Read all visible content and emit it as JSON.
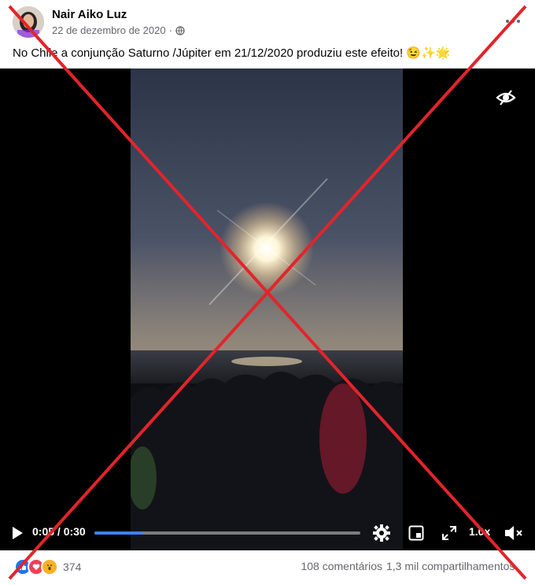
{
  "post": {
    "author": "Nair Aiko Luz",
    "date": "22 de dezembro de 2020",
    "date_separator": "·",
    "privacy_icon": "globe-icon",
    "caption": "No Chile a conjunção Saturno /Júpiter em 21/12/2020  produziu este efeito! 😉✨🌟"
  },
  "video": {
    "time_display": "0:05 / 0:30",
    "progress_fraction": 0.18,
    "speed_label": "1.0x",
    "icons": [
      "hide-icon",
      "play-icon",
      "settings-icon",
      "pip-icon",
      "fullscreen-icon",
      "mute-icon"
    ]
  },
  "footer": {
    "reaction_icons": [
      "like-icon",
      "love-icon",
      "wow-icon"
    ],
    "reaction_count": "374",
    "comments": "108 comentários",
    "shares": "1,3 mil compartilhamentos"
  },
  "colors": {
    "accent": "#3b82f6",
    "cross": "#e3242b",
    "like": "#1877f2",
    "love": "#f33e58",
    "wow": "#f7b125"
  }
}
